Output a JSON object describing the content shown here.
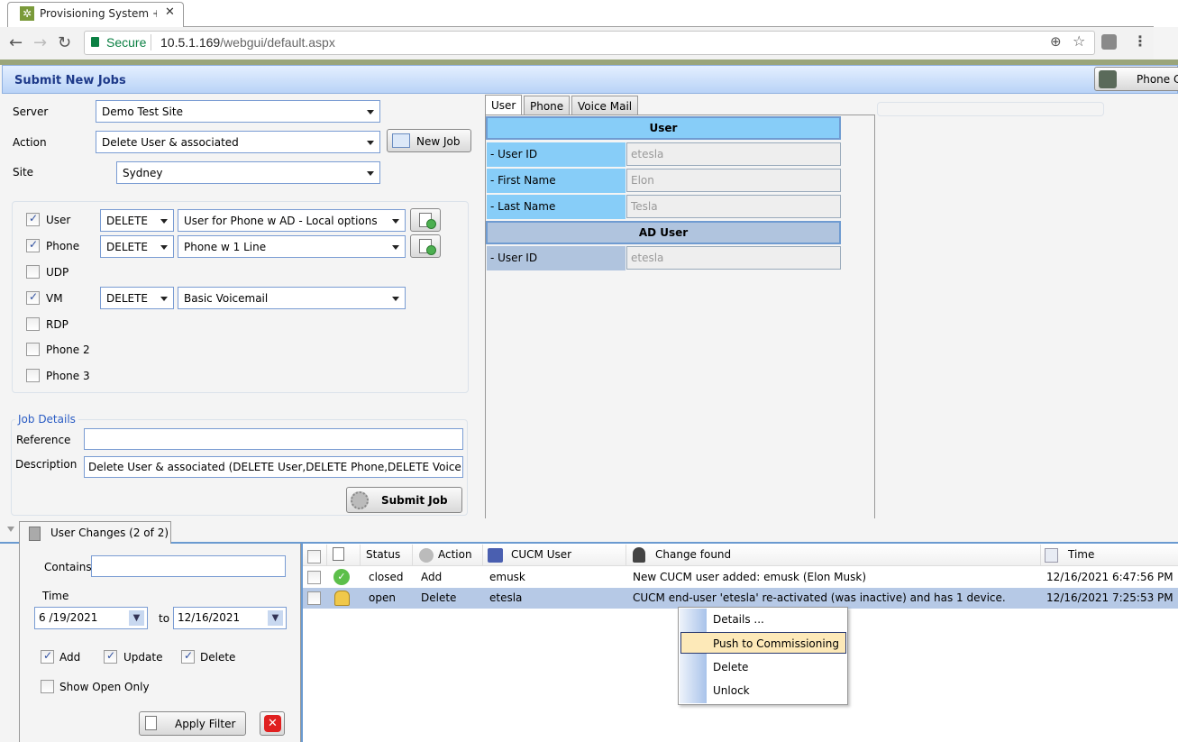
{
  "browser": {
    "tab_title": "Provisioning System + Ph",
    "secure_label": "Secure",
    "url_host": "10.5.1.169",
    "url_path": "/webgui/default.aspx"
  },
  "header": {
    "title": "Submit New Jobs",
    "phone_button": "Phone C"
  },
  "job_form": {
    "server_label": "Server",
    "server_value": "Demo Test Site",
    "action_label": "Action",
    "action_value": "Delete User & associated",
    "new_job_button": "New Job",
    "site_label": "Site",
    "site_value": "Sydney",
    "items": [
      {
        "label": "User",
        "checked": true,
        "op": "DELETE",
        "template": "User for Phone w AD - Local options",
        "has_button": true
      },
      {
        "label": "Phone",
        "checked": true,
        "op": "DELETE",
        "template": "Phone w 1 Line",
        "has_button": true
      },
      {
        "label": "UDP",
        "checked": false
      },
      {
        "label": "VM",
        "checked": true,
        "op": "DELETE",
        "template": "Basic Voicemail",
        "has_button": false
      },
      {
        "label": "RDP",
        "checked": false
      },
      {
        "label": "Phone 2",
        "checked": false
      },
      {
        "label": "Phone 3",
        "checked": false
      }
    ]
  },
  "job_details": {
    "legend": "Job Details",
    "reference_label": "Reference",
    "reference_value": "",
    "description_label": "Description",
    "description_value": "Delete User & associated (DELETE User,DELETE Phone,DELETE Voice Ma",
    "submit_button": "Submit Job"
  },
  "detail_tabs": [
    "User",
    "Phone",
    "Voice Mail"
  ],
  "detail": {
    "user_section": "User",
    "user_rows": [
      {
        "label": "- User ID",
        "value": "etesla"
      },
      {
        "label": "- First Name",
        "value": "Elon"
      },
      {
        "label": "- Last Name",
        "value": "Tesla"
      }
    ],
    "ad_section": "AD User",
    "ad_rows": [
      {
        "label": "- User ID",
        "value": "etesla"
      }
    ]
  },
  "changes_tab": "User Changes (2 of 2)",
  "filter": {
    "contains_label": "Contains",
    "contains_value": "",
    "time_label": "Time",
    "from_date": "6 /19/2021",
    "to_label": "to",
    "to_date": "12/16/2021",
    "add_label": "Add",
    "update_label": "Update",
    "delete_label": "Delete",
    "show_open_label": "Show Open Only",
    "apply_button": "Apply Filter"
  },
  "grid": {
    "columns": [
      "Status",
      "Action",
      "CUCM User",
      "Change found",
      "Time"
    ],
    "rows": [
      {
        "status": "closed",
        "action": "Add",
        "user": "emusk",
        "change": "New CUCM user added: emusk (Elon Musk)",
        "time": "12/16/2021 6:47:56 PM"
      },
      {
        "status": "open",
        "action": "Delete",
        "user": "etesla",
        "change": "CUCM end-user 'etesla' re-activated (was inactive) and has 1 device.",
        "time": "12/16/2021 7:25:53 PM"
      }
    ]
  },
  "context_menu": [
    "Details ...",
    "Push to Commissioning",
    "Delete",
    "Unlock"
  ]
}
